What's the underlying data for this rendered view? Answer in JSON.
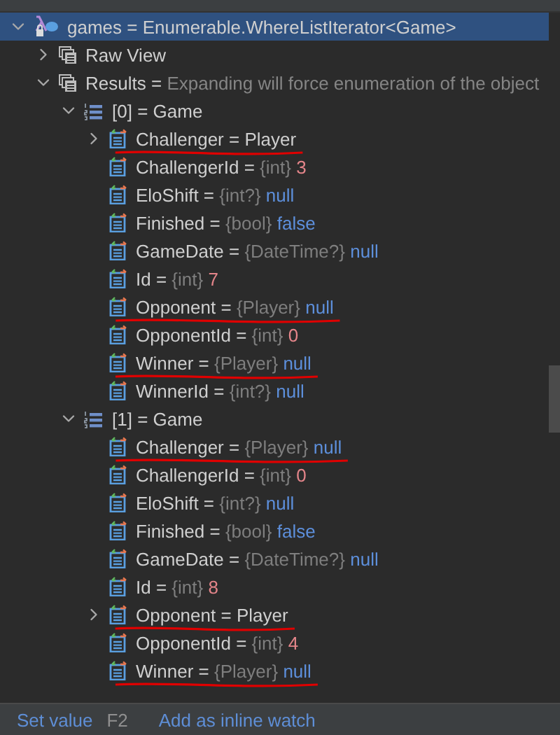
{
  "separator": "=",
  "tree": [
    {
      "kind": "root",
      "name": "games",
      "value": {
        "text": "Enumerable.WhereListIterator<Game>",
        "kind": "plain"
      },
      "expanded": true,
      "selected": true,
      "children": [
        {
          "kind": "group",
          "name": "Raw View",
          "expanded": false,
          "selected": false
        },
        {
          "kind": "group",
          "name": "Results",
          "value": {
            "text": "Expanding will force enumeration of the object",
            "kind": "hint"
          },
          "expanded": true,
          "selected": false,
          "children": [
            {
              "kind": "list",
              "name": "[0]",
              "value": {
                "text": "Game",
                "kind": "plain"
              },
              "expanded": true,
              "selected": false,
              "children": [
                {
                  "kind": "property",
                  "name": "Challenger",
                  "value": {
                    "text": "Player",
                    "kind": "plain"
                  },
                  "expanded": false,
                  "selected": false,
                  "underlined": true
                },
                {
                  "kind": "property",
                  "name": "ChallengerId",
                  "type": "{int}",
                  "value": {
                    "text": "3",
                    "kind": "number"
                  },
                  "selected": false,
                  "underlined": false
                },
                {
                  "kind": "property",
                  "name": "EloShift",
                  "type": "{int?}",
                  "value": {
                    "text": "null",
                    "kind": "keyword"
                  },
                  "selected": false,
                  "underlined": false
                },
                {
                  "kind": "property",
                  "name": "Finished",
                  "type": "{bool}",
                  "value": {
                    "text": "false",
                    "kind": "keyword"
                  },
                  "selected": false,
                  "underlined": false
                },
                {
                  "kind": "property",
                  "name": "GameDate",
                  "type": "{DateTime?}",
                  "value": {
                    "text": "null",
                    "kind": "keyword"
                  },
                  "selected": false,
                  "underlined": false
                },
                {
                  "kind": "property",
                  "name": "Id",
                  "type": "{int}",
                  "value": {
                    "text": "7",
                    "kind": "number"
                  },
                  "selected": false,
                  "underlined": false
                },
                {
                  "kind": "property",
                  "name": "Opponent",
                  "type": "{Player}",
                  "value": {
                    "text": "null",
                    "kind": "keyword"
                  },
                  "selected": false,
                  "underlined": true
                },
                {
                  "kind": "property",
                  "name": "OpponentId",
                  "type": "{int}",
                  "value": {
                    "text": "0",
                    "kind": "number"
                  },
                  "selected": false,
                  "underlined": false
                },
                {
                  "kind": "property",
                  "name": "Winner",
                  "type": "{Player}",
                  "value": {
                    "text": "null",
                    "kind": "keyword"
                  },
                  "selected": false,
                  "underlined": true
                },
                {
                  "kind": "property",
                  "name": "WinnerId",
                  "type": "{int?}",
                  "value": {
                    "text": "null",
                    "kind": "keyword"
                  },
                  "selected": false,
                  "underlined": false
                }
              ]
            },
            {
              "kind": "list",
              "name": "[1]",
              "value": {
                "text": "Game",
                "kind": "plain"
              },
              "expanded": true,
              "selected": false,
              "children": [
                {
                  "kind": "property",
                  "name": "Challenger",
                  "type": "{Player}",
                  "value": {
                    "text": "null",
                    "kind": "keyword"
                  },
                  "selected": false,
                  "underlined": true
                },
                {
                  "kind": "property",
                  "name": "ChallengerId",
                  "type": "{int}",
                  "value": {
                    "text": "0",
                    "kind": "number"
                  },
                  "selected": false,
                  "underlined": false
                },
                {
                  "kind": "property",
                  "name": "EloShift",
                  "type": "{int?}",
                  "value": {
                    "text": "null",
                    "kind": "keyword"
                  },
                  "selected": false,
                  "underlined": false
                },
                {
                  "kind": "property",
                  "name": "Finished",
                  "type": "{bool}",
                  "value": {
                    "text": "false",
                    "kind": "keyword"
                  },
                  "selected": false,
                  "underlined": false
                },
                {
                  "kind": "property",
                  "name": "GameDate",
                  "type": "{DateTime?}",
                  "value": {
                    "text": "null",
                    "kind": "keyword"
                  },
                  "selected": false,
                  "underlined": false
                },
                {
                  "kind": "property",
                  "name": "Id",
                  "type": "{int}",
                  "value": {
                    "text": "8",
                    "kind": "number"
                  },
                  "selected": false,
                  "underlined": false
                },
                {
                  "kind": "property",
                  "name": "Opponent",
                  "value": {
                    "text": "Player",
                    "kind": "plain"
                  },
                  "expanded": false,
                  "selected": false,
                  "underlined": true
                },
                {
                  "kind": "property",
                  "name": "OpponentId",
                  "type": "{int}",
                  "value": {
                    "text": "4",
                    "kind": "number"
                  },
                  "selected": false,
                  "underlined": false
                },
                {
                  "kind": "property",
                  "name": "Winner",
                  "type": "{Player}",
                  "value": {
                    "text": "null",
                    "kind": "keyword"
                  },
                  "selected": false,
                  "underlined": true
                }
              ]
            }
          ]
        }
      ]
    }
  ],
  "footer": {
    "actions": [
      {
        "label": "Set value",
        "shortcut": "F2"
      },
      {
        "label": "Add as inline watch"
      }
    ]
  }
}
